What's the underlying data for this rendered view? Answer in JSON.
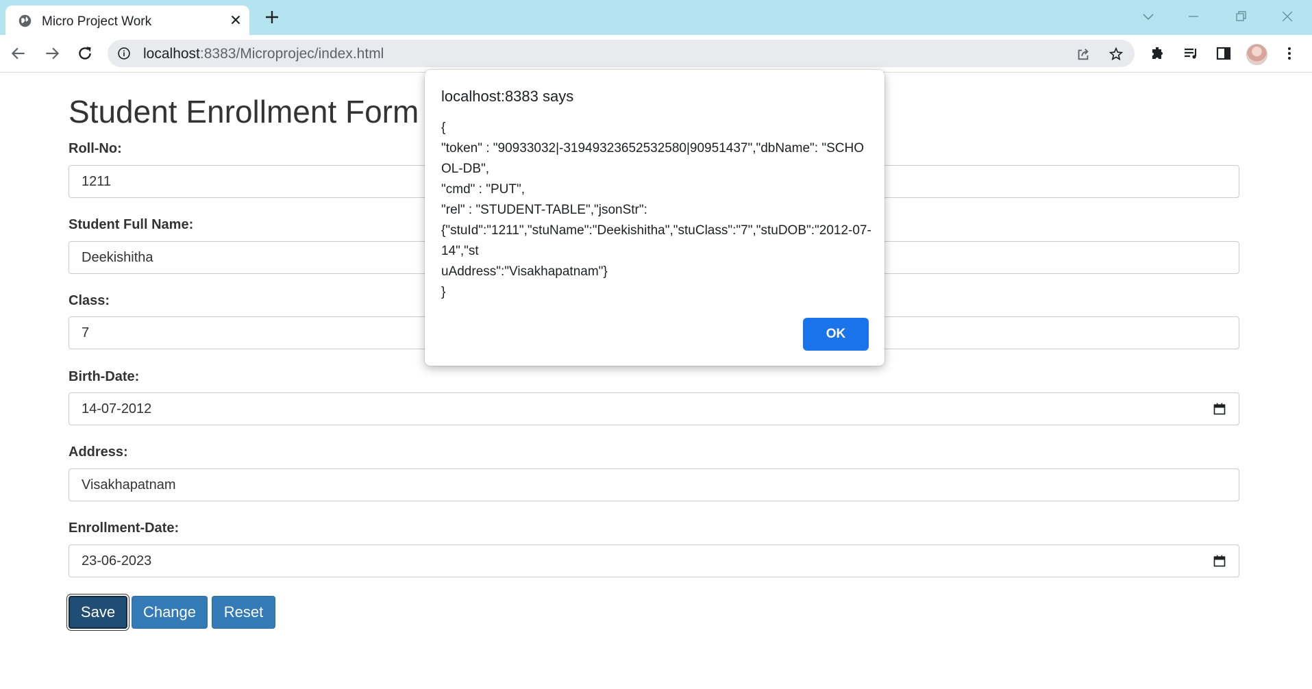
{
  "browser": {
    "tab_title": "Micro Project Work",
    "url_host": "localhost",
    "url_path": ":8383/Microprojec/index.html"
  },
  "form": {
    "title": "Student Enrollment Form (",
    "fields": [
      {
        "label": "Roll-No:",
        "value": "1211"
      },
      {
        "label": "Student Full Name:",
        "value": "Deekishitha"
      },
      {
        "label": "Class:",
        "value": "7"
      },
      {
        "label": "Birth-Date:",
        "value": "14-07-2012"
      },
      {
        "label": "Address:",
        "value": "Visakhapatnam"
      },
      {
        "label": "Enrollment-Date:",
        "value": "23-06-2023"
      }
    ],
    "buttons": {
      "save": "Save",
      "change": "Change",
      "reset": "Reset"
    }
  },
  "dialog": {
    "title": "localhost:8383 says",
    "message": "{\n\"token\" : \"90933032|-31949323652532580|90951437\",\"dbName\": \"SCHOOL-DB\",\n\"cmd\" : \"PUT\",\n\"rel\" : \"STUDENT-TABLE\",\"jsonStr\":\n{\"stuId\":\"1211\",\"stuName\":\"Deekishitha\",\"stuClass\":\"7\",\"stuDOB\":\"2012-07-14\",\"st\nuAddress\":\"Visakhapatnam\"}\n}",
    "ok_label": "OK"
  }
}
